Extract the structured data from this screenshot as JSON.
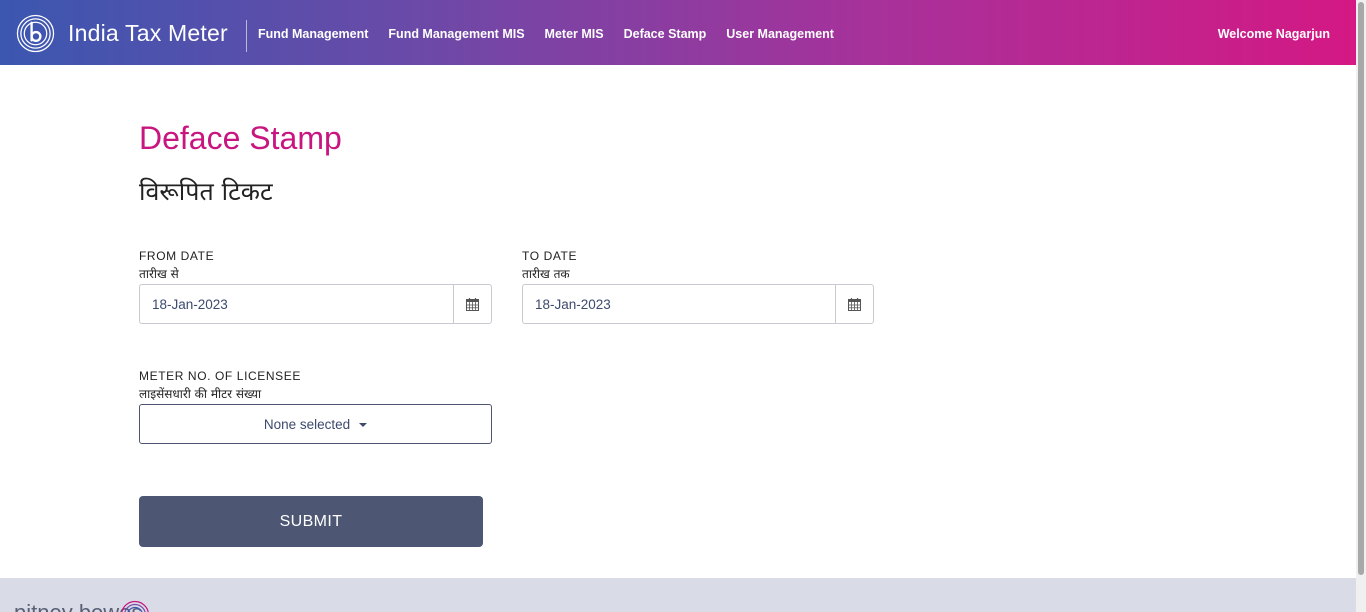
{
  "header": {
    "brand": "India Tax Meter",
    "nav": [
      {
        "label": "Fund Management"
      },
      {
        "label": "Fund Management MIS"
      },
      {
        "label": "Meter MIS"
      },
      {
        "label": "Deface Stamp"
      },
      {
        "label": "User Management"
      }
    ],
    "welcome": "Welcome Nagarjun"
  },
  "page": {
    "title": "Deface Stamp",
    "title_hindi": "विरूपित टिकट"
  },
  "form": {
    "from_date": {
      "label": "FROM DATE",
      "label_hindi": "तारीख से",
      "value": "18-Jan-2023"
    },
    "to_date": {
      "label": "TO DATE",
      "label_hindi": "तारीख तक",
      "value": "18-Jan-2023"
    },
    "meter": {
      "label": "METER NO. OF LICENSEE",
      "label_hindi": "लाइसेंसधारी की मीटर संख्या",
      "selected": "None selected"
    },
    "submit_label": "SUBMIT"
  },
  "footer": {
    "brand": "pitney bowes"
  },
  "colors": {
    "accent": "#c8157f",
    "button": "#4d5774",
    "header_start": "#3b57b0",
    "header_end": "#d41884"
  }
}
